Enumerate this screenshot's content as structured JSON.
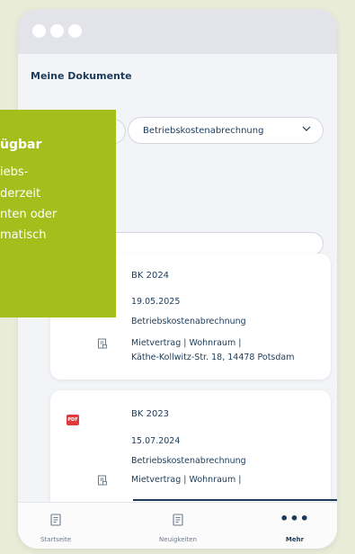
{
  "page": {
    "title": "Meine Dokumente"
  },
  "filter": {
    "dropdown_label": "Betriebskostenabrechnung"
  },
  "documents": [
    {
      "name": "BK 2024",
      "date": "19.05.2025",
      "type": "Betriebskostenabrechnung",
      "contract": "Mietvertrag | Wohnraum |",
      "address": "Käthe-Kollwitz-Str. 18, 14478 Potsdam",
      "has_pdf_badge": false
    },
    {
      "name": "BK 2023",
      "date": "15.07.2024",
      "type": "Betriebskostenabrechnung",
      "contract": "Mietvertrag | Wohnraum |",
      "pdf_badge": "PDF",
      "has_pdf_badge": true
    }
  ],
  "tabbar": [
    {
      "label": "Startseite",
      "icon": "document-icon",
      "active": false
    },
    {
      "label": "Neuigkeiten",
      "icon": "news-icon",
      "active": false
    },
    {
      "label": "Mehr",
      "icon": "more-icon",
      "active": true,
      "glyph": "•••"
    }
  ],
  "tooltip": {
    "title": "ügbar",
    "lines": [
      "iebs-",
      "derzeit",
      "nten oder",
      "matisch"
    ]
  },
  "colors": {
    "accent": "#a4be1b",
    "text": "#1c3b5a",
    "pdf": "#e23a3a",
    "background": "#e9ecd8"
  }
}
